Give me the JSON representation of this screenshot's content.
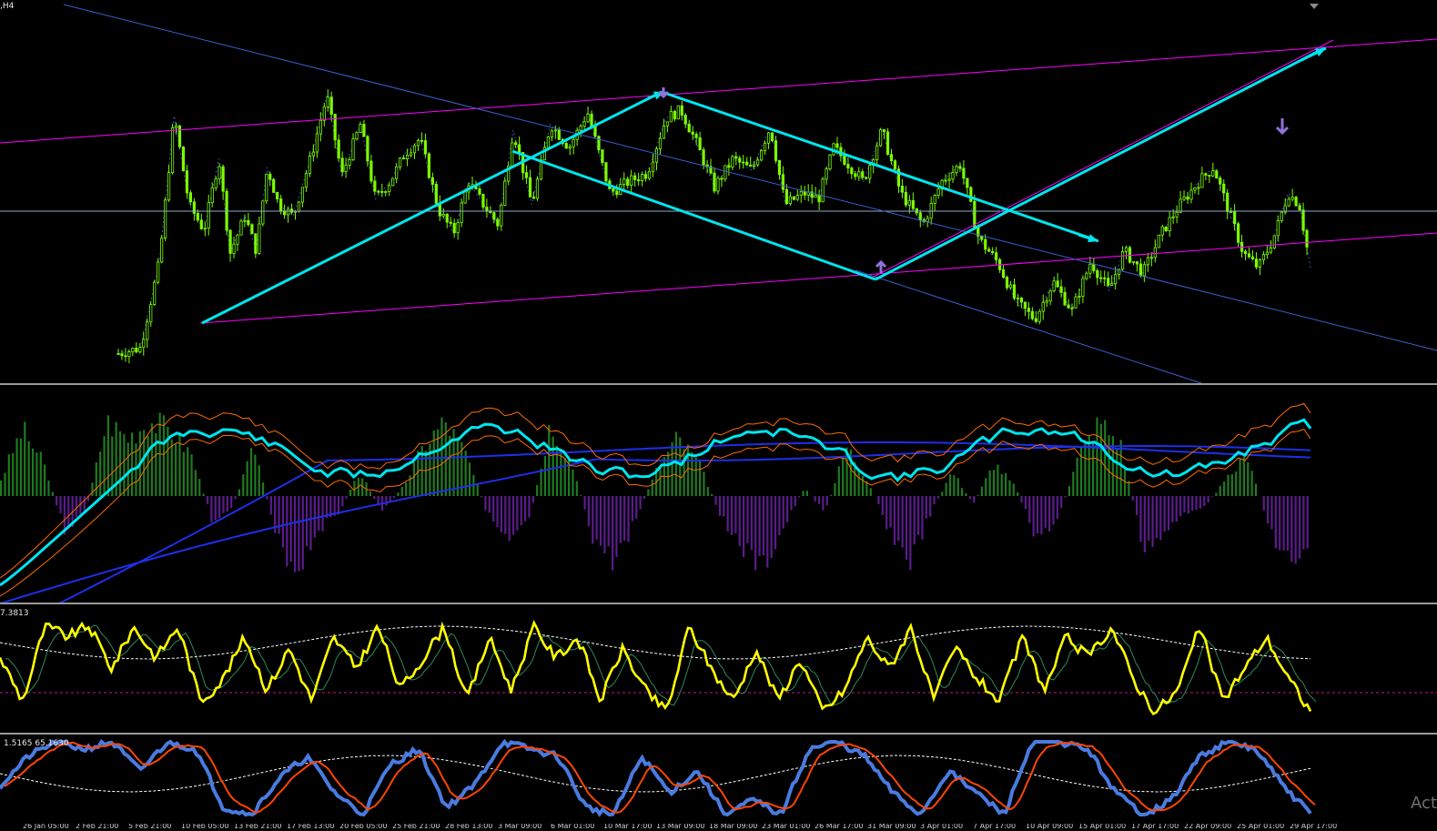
{
  "window": {
    "timeframe_label": ",H4",
    "scroll_icon": "shift-end-marker-icon",
    "watermark": "Act"
  },
  "colors": {
    "candle": "#7CFC00",
    "trend_arrow": "#00E5EE",
    "channel_magenta": "#FF00FF",
    "channel_blue": "#3A5FCD",
    "zigzag_dotted": "#3A5FCD",
    "horizontal_level": "#8FA8C8",
    "arrow_up": "#9370DB",
    "arrow_down": "#9370DB",
    "histogram_positive": "#1F7A1F",
    "histogram_negative": "#5B1C8C",
    "rsi_main": "#00E5EE",
    "band_blue": "#1E2FE8",
    "band_orange": "#FF6A00",
    "stoch_main": "#FFFF00",
    "stoch_signal": "#2E8B57",
    "stoch_ma": "#FFFFFF",
    "level_dotted": "#C71585",
    "rsi2_main": "#4A7BE0",
    "rsi2_signal": "#FF4500"
  },
  "chart_data": [
    {
      "type": "candlestick",
      "panel": "price",
      "timeframe": "H4",
      "grid": false,
      "price_path": [
        [
          0.0,
          0.1
        ],
        [
          0.06,
          0.12
        ],
        [
          0.11,
          0.42
        ],
        [
          0.15,
          0.93
        ],
        [
          0.19,
          0.62
        ],
        [
          0.23,
          0.53
        ],
        [
          0.27,
          0.78
        ],
        [
          0.3,
          0.45
        ],
        [
          0.34,
          0.58
        ],
        [
          0.37,
          0.46
        ],
        [
          0.4,
          0.75
        ],
        [
          0.43,
          0.62
        ],
        [
          0.47,
          0.58
        ],
        [
          0.52,
          0.8
        ],
        [
          0.56,
          1.0
        ],
        [
          0.6,
          0.72
        ],
        [
          0.65,
          0.9
        ],
        [
          0.69,
          0.64
        ],
        [
          0.73,
          0.7
        ],
        [
          0.77,
          0.8
        ],
        [
          0.81,
          0.85
        ],
        [
          0.86,
          0.6
        ],
        [
          0.9,
          0.52
        ],
        [
          0.94,
          0.7
        ],
        [
          0.98,
          0.62
        ],
        [
          1.02,
          0.55
        ],
        [
          1.06,
          0.88
        ],
        [
          1.11,
          0.62
        ],
        [
          1.16,
          0.9
        ],
        [
          1.21,
          0.82
        ],
        [
          1.26,
          0.94
        ],
        [
          1.32,
          0.66
        ],
        [
          1.37,
          0.7
        ],
        [
          1.42,
          0.73
        ],
        [
          1.47,
          0.92
        ],
        [
          1.51,
          0.95
        ],
        [
          1.55,
          0.84
        ],
        [
          1.6,
          0.68
        ],
        [
          1.65,
          0.78
        ],
        [
          1.7,
          0.74
        ],
        [
          1.75,
          0.89
        ],
        [
          1.79,
          0.62
        ],
        [
          1.84,
          0.66
        ],
        [
          1.88,
          0.64
        ],
        [
          1.92,
          0.82
        ],
        [
          1.96,
          0.76
        ],
        [
          2.0,
          0.7
        ],
        [
          2.05,
          0.88
        ],
        [
          2.1,
          0.66
        ],
        [
          2.16,
          0.55
        ],
        [
          2.21,
          0.7
        ],
        [
          2.26,
          0.76
        ],
        [
          2.31,
          0.5
        ],
        [
          2.36,
          0.42
        ],
        [
          2.41,
          0.28
        ],
        [
          2.46,
          0.22
        ],
        [
          2.51,
          0.35
        ],
        [
          2.56,
          0.25
        ],
        [
          2.61,
          0.42
        ],
        [
          2.66,
          0.32
        ],
        [
          2.7,
          0.46
        ],
        [
          2.75,
          0.38
        ],
        [
          2.8,
          0.52
        ],
        [
          2.85,
          0.62
        ],
        [
          2.9,
          0.7
        ],
        [
          2.94,
          0.75
        ],
        [
          2.98,
          0.6
        ],
        [
          3.02,
          0.45
        ],
        [
          3.06,
          0.4
        ],
        [
          3.1,
          0.5
        ],
        [
          3.14,
          0.66
        ],
        [
          3.17,
          0.62
        ],
        [
          3.2,
          0.4
        ]
      ]
    },
    {
      "type": "histogram",
      "panel": "oscillator_histogram",
      "series": [
        {
          "name": "histogram",
          "values": [
            0.2,
            0.8,
            0.4,
            -0.4,
            -0.2,
            0.9,
            0.7,
            0.9,
            0.8,
            0.5,
            -0.3,
            -0.1,
            0.6,
            -0.5,
            -0.9,
            -0.4,
            -0.2,
            0.3,
            -0.2,
            0.1,
            0.6,
            0.9,
            0.5,
            -0.2,
            -0.6,
            -0.3,
            0.9,
            0.4,
            -0.5,
            -0.8,
            -0.3,
            0.3,
            0.7,
            0.4,
            -0.2,
            -0.6,
            -0.9,
            -0.4,
            0.1,
            -0.2,
            0.6,
            0.2,
            -0.4,
            -0.8,
            -0.2,
            0.3,
            -0.1,
            0.4,
            0.1,
            -0.5,
            -0.3,
            0.5,
            0.9,
            0.6,
            -0.6,
            -0.5,
            -0.2,
            -0.1,
            0.2,
            0.5,
            -0.4,
            -0.8,
            -0.7
          ]
        }
      ]
    },
    {
      "type": "line",
      "panel": "stochastic",
      "reference_level_dotted": true,
      "series": [
        {
          "name": "main",
          "values": [
            0.6,
            0.2,
            0.9,
            0.8,
            0.9,
            0.5,
            0.9,
            0.6,
            0.9,
            0.2,
            0.4,
            0.8,
            0.3,
            0.7,
            0.2,
            0.8,
            0.5,
            0.9,
            0.3,
            0.6,
            0.9,
            0.2,
            0.8,
            0.3,
            0.9,
            0.6,
            0.8,
            0.2,
            0.7,
            0.3,
            0.1,
            0.9,
            0.5,
            0.2,
            0.7,
            0.2,
            0.6,
            0.1,
            0.3,
            0.8,
            0.5,
            0.9,
            0.2,
            0.7,
            0.4,
            0.2,
            0.8,
            0.3,
            0.8,
            0.6,
            0.9,
            0.4,
            0.1,
            0.3,
            0.9,
            0.2,
            0.5,
            0.8,
            0.4,
            0.1
          ]
        }
      ]
    },
    {
      "type": "line",
      "panel": "rsi_lower",
      "series": [
        {
          "name": "main",
          "values": [
            0.4,
            0.8,
            1.0,
            0.9,
            1.0,
            0.6,
            1.0,
            0.9,
            0.1,
            0.0,
            0.5,
            0.8,
            0.3,
            0.0,
            0.7,
            0.9,
            0.1,
            0.4,
            1.0,
            0.9,
            0.8,
            0.1,
            0.0,
            0.8,
            0.3,
            0.6,
            0.0,
            0.2,
            0.0,
            0.9,
            1.0,
            0.8,
            0.3,
            0.0,
            0.6,
            0.3,
            0.0,
            1.0,
            1.0,
            0.9,
            0.3,
            0.0,
            0.2,
            0.8,
            1.0,
            0.9,
            0.4,
            0.0
          ]
        }
      ]
    }
  ],
  "indicators": {
    "stochastic_header": "7.3813",
    "rsi_header": "1.5165 65.1630"
  },
  "time_axis": {
    "ticks": [
      "26 Jan 05:00",
      "2 Feb 21:00",
      "5 Feb 21:00",
      "10 Feb 05:00",
      "13 Feb 21:00",
      "17 Feb 13:00",
      "20 Feb 05:00",
      "25 Feb 21:00",
      "28 Feb 13:00",
      "3 Mar 09:00",
      "6 Mar 01:00",
      "10 Mar 17:00",
      "13 Mar 09:00",
      "18 Mar 09:00",
      "23 Mar 01:00",
      "26 Mar 17:00",
      "31 Mar 09:00",
      "3 Apr 01:00",
      "7 Apr 17:00",
      "10 Apr 09:00",
      "15 Apr 01:00",
      "17 Apr 17:00",
      "22 Apr 09:00",
      "25 Apr 01:00",
      "29 Apr 17:00"
    ]
  }
}
